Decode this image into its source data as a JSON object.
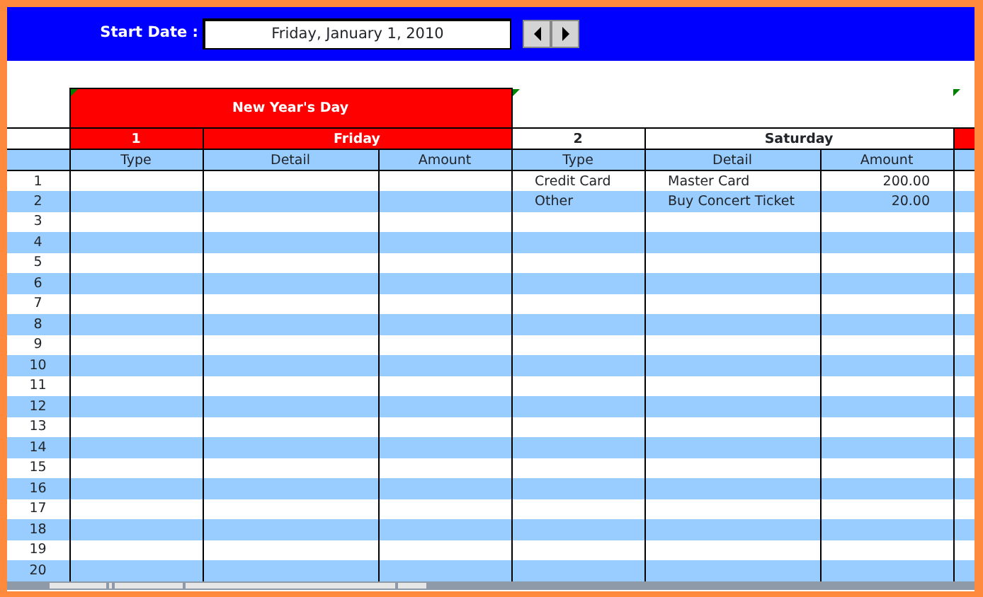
{
  "toolbar": {
    "start_date_label": "Start Date :",
    "start_date": "Friday, January 1, 2010"
  },
  "row_numbers": [
    "1",
    "2",
    "3",
    "4",
    "5",
    "6",
    "7",
    "8",
    "9",
    "10",
    "11",
    "12",
    "13",
    "14",
    "15",
    "16",
    "17",
    "18",
    "19",
    "20"
  ],
  "days": [
    {
      "number": "1",
      "weekday": "Friday",
      "holiday": "New Year's Day",
      "highlighted": true,
      "comment": true,
      "columns": [
        "Type",
        "Detail",
        "Amount"
      ]
    },
    {
      "number": "2",
      "weekday": "Saturday",
      "highlighted": false,
      "comment": true,
      "columns": [
        "Type",
        "Detail",
        "Amount"
      ],
      "entries": [
        {
          "type": "Credit Card",
          "detail": "Master Card",
          "amount": "200.00"
        },
        {
          "type": "Other",
          "detail": "Buy Concert Ticket",
          "amount": "20.00"
        }
      ]
    },
    {
      "highlighted": true,
      "comment": true,
      "kind": "partial"
    }
  ]
}
